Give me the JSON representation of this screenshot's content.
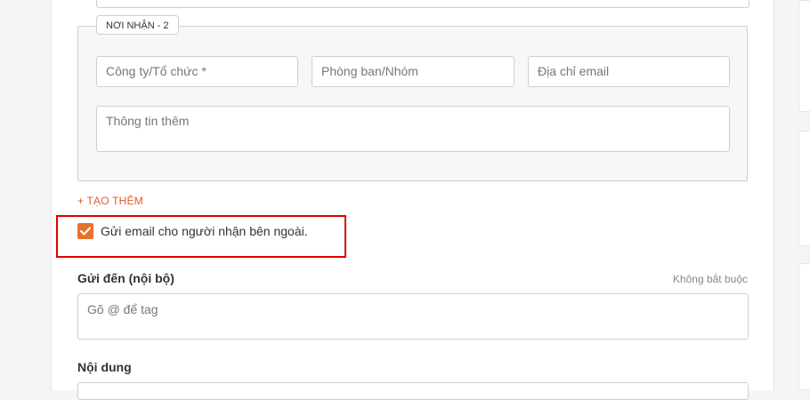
{
  "recipient": {
    "legend": "NƠI NHẬN - 2",
    "company_placeholder": "Công ty/Tổ chức *",
    "department_placeholder": "Phòng ban/Nhóm",
    "email_placeholder": "Địa chỉ email",
    "info_placeholder": "Thông tin thêm"
  },
  "add_more_label": "+ TẠO THÊM",
  "external_email": {
    "checked": true,
    "label": "Gửi email cho người nhận bên ngoài."
  },
  "send_to": {
    "label": "Gửi đến (nội bộ)",
    "optional_hint": "Không bắt buộc",
    "placeholder": "Gõ @ để tag"
  },
  "content": {
    "label": "Nội dung"
  },
  "colors": {
    "accent": "#e8702a",
    "link": "#e05a2b",
    "highlight": "#e00000"
  },
  "icons": {
    "checkbox": "checkmark-icon"
  }
}
